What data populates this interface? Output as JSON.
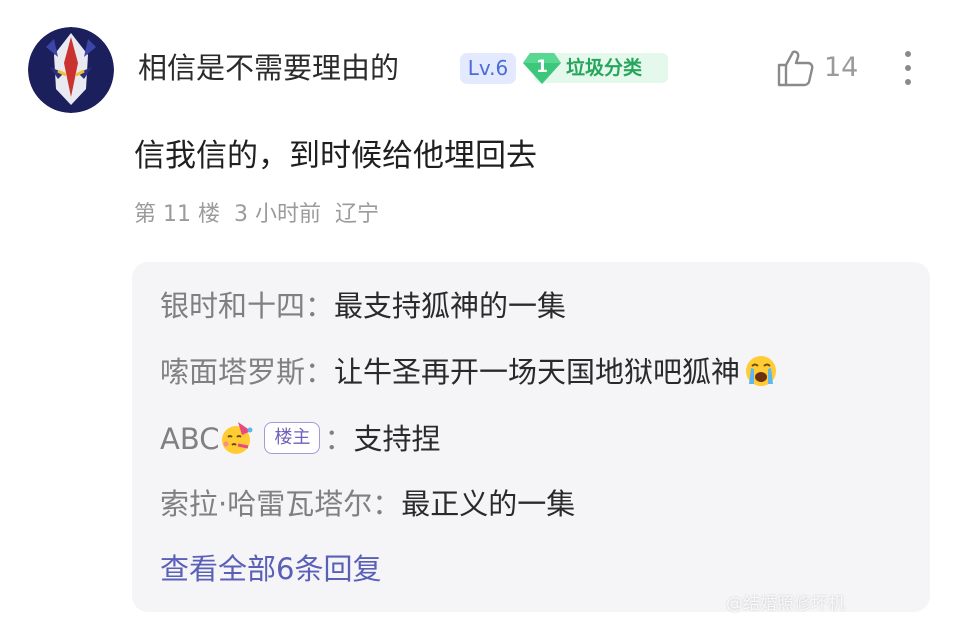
{
  "comment": {
    "username": "相信是不需要理由的",
    "level_badge": "Lv.6",
    "fan_badge": {
      "level": "1",
      "name": "垃圾分类"
    },
    "like_count": "14",
    "text": "信我信的，到时候给他埋回去",
    "meta": {
      "floor": "第 11 楼",
      "time": "3 小时前",
      "location": "辽宁"
    }
  },
  "replies": [
    {
      "author": "银时和十四",
      "separator": "：",
      "text": "最支持狐神的一集",
      "emoji": null,
      "is_op": false
    },
    {
      "author": "嗦面塔罗斯",
      "separator": "：",
      "text": "让牛圣再开一场天国地狱吧狐神",
      "emoji": "crying-face-icon",
      "is_op": false
    },
    {
      "author": "ABC",
      "separator": "：",
      "text": "支持捏",
      "emoji": "party-face-icon",
      "is_op": true,
      "op_label": "楼主"
    },
    {
      "author": "索拉·哈雷瓦塔尔",
      "separator": "：",
      "text": "最正义的一集",
      "emoji": null,
      "is_op": false
    }
  ],
  "view_all_label": "查看全部6条回复",
  "watermark": "@结婚照修坏机",
  "colors": {
    "level_badge_bg": "#e3eaff",
    "level_badge_text": "#4a6bd8",
    "fan_badge_bg": "#e5f8ec",
    "fan_badge_text": "#26a65b",
    "reply_box_bg": "#f5f5f7",
    "view_all": "#5a5fb8"
  }
}
